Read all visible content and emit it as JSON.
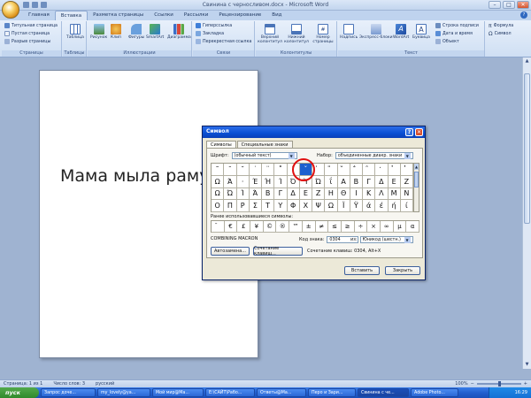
{
  "window": {
    "title": "Свинина с черносливом.docx - Microsoft Word",
    "controls": [
      "–",
      "□",
      "✕"
    ]
  },
  "ribbon_tabs": [
    "Главная",
    "Вставка",
    "Разметка страницы",
    "Ссылки",
    "Рассылки",
    "Рецензирование",
    "Вид"
  ],
  "active_tab": "Вставка",
  "ribbon": {
    "pages": {
      "label": "Страницы",
      "items": [
        "Титульная страница",
        "Пустая страница",
        "Разрыв страницы"
      ]
    },
    "tables": {
      "label": "Таблицы",
      "item": "Таблица"
    },
    "illustrations": {
      "label": "Иллюстрации",
      "items": [
        "Рисунок",
        "Клип",
        "Фигуры",
        "SmartArt",
        "Диаграмма"
      ]
    },
    "links": {
      "label": "Связи",
      "items": [
        "Гиперссылка",
        "Закладка",
        "Перекрестная ссылка"
      ]
    },
    "header_footer": {
      "label": "Колонтитулы",
      "items": [
        "Верхний колонтитул",
        "Нижний колонтитул",
        "Номер страницы"
      ]
    },
    "text": {
      "label": "Текст",
      "items": [
        "Надпись",
        "Экспресс-блоки",
        "WordArt",
        "Буквица"
      ],
      "small": [
        "Строка подписи",
        "Дата и время",
        "Объект"
      ]
    },
    "symbols": {
      "items": [
        "Формула",
        "Символ"
      ]
    }
  },
  "document": {
    "text": "Мама мылa раму"
  },
  "dialog": {
    "title": "Символ",
    "tabs": [
      "Символы",
      "Специальные знаки"
    ],
    "font_label": "Шрифт:",
    "font_value": "(обычный текст)",
    "subset_label": "Набор:",
    "subset_value": "объединенные диакр. знаки",
    "symbols_rows": [
      [
        "˜",
        "¯",
        "˘",
        "˙",
        "¨",
        "˚",
        "˝",
        "ˇ",
        "̍",
        "̎",
        "̏",
        "̐",
        "̑",
        "̒",
        "̓",
        "̔"
      ],
      [
        "Ω",
        "Ά",
        "·",
        "Έ",
        "Ή",
        "Ί",
        "Ό",
        "Ύ",
        "Ώ",
        "ΐ",
        "Α",
        "Β",
        "Γ",
        "Δ",
        "Ε",
        "Ζ"
      ],
      [
        "Ω",
        "Ώ",
        "Ί",
        "Ά",
        "Β",
        "Γ",
        "Δ",
        "Ε",
        "Ζ",
        "Η",
        "Θ",
        "Ι",
        "Κ",
        "Λ",
        "Μ",
        "Ν"
      ],
      [
        "Ο",
        "Π",
        "Ρ",
        "Σ",
        "Τ",
        "Υ",
        "Φ",
        "Χ",
        "Ψ",
        "Ω",
        "Ϊ",
        "Ϋ",
        "ά",
        "έ",
        "ή",
        "ί"
      ]
    ],
    "selected_cell": "0-7",
    "recent_label": "Ранее использовавшиеся символы:",
    "recent_symbols": [
      "̄",
      "€",
      "£",
      "¥",
      "©",
      "®",
      "™",
      "±",
      "≠",
      "≤",
      "≥",
      "÷",
      "×",
      "∞",
      "µ",
      "α"
    ],
    "char_name": "COMBINING MACRON",
    "code_label": "Код знака:",
    "code_value": "0304",
    "from_label": "из:",
    "from_value": "Юникод (шестн.)",
    "autocorrect_button": "Автозамена...",
    "shortcut_button": "Сочетание клавиш...",
    "shortcut_text": "Сочетание клавиш: 0304, Alt+X",
    "insert_button": "Вставить",
    "close_button": "Закрыть"
  },
  "status": {
    "page": "Страница: 1 из 1",
    "words": "Число слов: 3",
    "lang": "русский",
    "zoom": "100%"
  },
  "taskbar": {
    "start": "пуск",
    "items": [
      "Запрос доче...",
      "my_lovely@ya...",
      "Мой мир@Ма...",
      "E:\\САЙТ\\Рабо...",
      "Ответы@Ma...",
      "Перо и Зари...",
      "Свинина с че...",
      "Adobe Photo..."
    ],
    "tray_time": "16:29"
  }
}
